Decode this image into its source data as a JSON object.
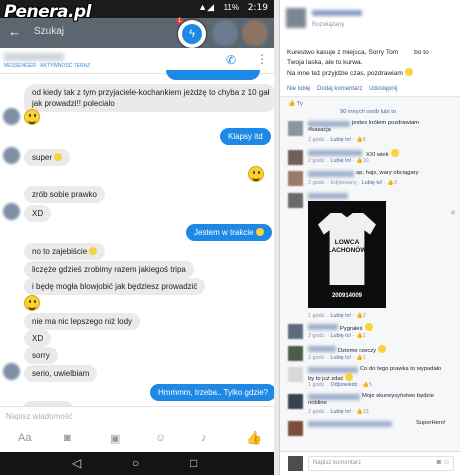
{
  "watermark": "Penera.pl",
  "statusbar": {
    "time": "2:19",
    "battery": "11%"
  },
  "search": {
    "placeholder": "Szukaj",
    "back_icon": "arrow-left-icon"
  },
  "chathead": {
    "badge": "1",
    "icon": "messenger-icon"
  },
  "conversation": {
    "subtitle": "MESSENGER · AKTYWNOŚĆ TERAZ"
  },
  "messages": [
    {
      "dir": "in",
      "text": "od kiedy tak z tym przyjaciele-kochankiem jeżdżę to chyba z 10 gał"
    },
    {
      "dir": "in",
      "text": "jak prowadzi!! polecialo"
    },
    {
      "dir": "out",
      "text": "Klapsy itd"
    },
    {
      "dir": "in",
      "text": "super"
    },
    {
      "dir": "in",
      "text": "zrób sobie prawko"
    },
    {
      "dir": "in",
      "text": "XD"
    },
    {
      "dir": "out",
      "text": "Jestem w trakcie"
    },
    {
      "dir": "in",
      "text": "no to zajebiście"
    },
    {
      "dir": "in",
      "text": "liczęże gdzieś zrobimy razem jakiegoś tripa"
    },
    {
      "dir": "in",
      "text": "i będę mogła blowjobić jak będziesz prowadzić"
    },
    {
      "dir": "in",
      "text": "nie ma nic lepszego niż lody"
    },
    {
      "dir": "in",
      "text": "XD"
    },
    {
      "dir": "in",
      "text": "sorry"
    },
    {
      "dir": "in",
      "text": "serio, uwielbiam"
    },
    {
      "dir": "out",
      "text": "Hmmmm, trzeba.. Tylko gdzie?"
    }
  ],
  "composer": {
    "placeholder": "Napisz wiadomość"
  },
  "fb": {
    "post_meta": "Rozwiązany",
    "post_lines": [
      "Kurestwo kasuje z miejsca, Sorry Tom",
      "Twoja laska, ale to kurwa.",
      "Na inne też przyjdzie czas, pozdrawiam"
    ],
    "post_tail": "bo to",
    "actions": [
      "Nie lubię",
      "Dodaj komentarz",
      "Udostępnij"
    ],
    "likes_text": "90 innych osób lubi to",
    "comments": [
      {
        "text": "jestes królem pozdrawiam",
        "text2": "#kasacja",
        "meta": "2 godz.",
        "likes": "6"
      },
      {
        "text": "XXI wiek",
        "meta": "2 godz.",
        "likes": "10"
      },
      {
        "text": "ap, hajs, wary obciągary",
        "meta": "2 godz. · Edytowany",
        "likes": "3"
      },
      {
        "text": "",
        "meta": "1 godz.",
        "likes": "2"
      },
      {
        "text": "Pygrałeś",
        "meta": "2 godz.",
        "likes": "1"
      },
      {
        "text": "Dzieme rzeczy",
        "meta": "2 godz.",
        "likes": "1"
      },
      {
        "text": "Co do tego prawka to wypadało",
        "text2": "by to już zdać",
        "meta": "1 godz.",
        "likes": "5"
      },
      {
        "text": "Moje skurwysyństwo będzie",
        "text2": "nobline",
        "meta": "2 godz.",
        "likes": "13"
      },
      {
        "text": "SuperHero!",
        "meta": "",
        "likes": ""
      }
    ],
    "shirt": {
      "line1": "LOWCA",
      "line2": "LACHONÓW",
      "number": "200914009"
    },
    "comment_placeholder": "Napisz komentarz",
    "like_label": "Lubię to!",
    "reply_label": "Odpowiedz"
  }
}
